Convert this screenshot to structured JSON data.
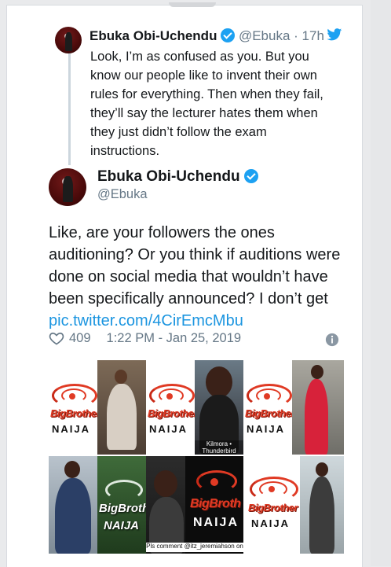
{
  "quoted_tweet": {
    "display_name": "Ebuka Obi-Uchendu",
    "handle": "@Ebuka",
    "separator": "·",
    "time_ago": "17h",
    "text": "Look, I’m as confused as you. But you know our people like to invent their own rules for everything. Then when they fail, they’ll say the lecturer hates them when they just didn’t follow the exam instructions."
  },
  "main_tweet": {
    "display_name": "Ebuka Obi-Uchendu",
    "handle": "@Ebuka",
    "text": "Like, are your followers the ones auditioning? Or you think if auditions were done on social media that wouldn’t have been specifically announced? I don’t get ",
    "link": "pic.twitter.com/4CirEmcMbu",
    "likes": "409",
    "timestamp": "1:22 PM - Jan 25, 2019"
  },
  "media": {
    "logo_word": "BigBrother",
    "logo_word_short": "BigBroth",
    "logo_naija": "NAIJA",
    "caption_1": "Kilmora • Thunderbird",
    "caption_2": "Pls comment @itz_jeremiahson on"
  },
  "colors": {
    "accent": "#1da1f2",
    "link": "#1b95e0",
    "bbn_red": "#e03a24",
    "muted_text": "#657786"
  },
  "icons": {
    "verified": "verified-badge-icon",
    "twitter": "twitter-bird-icon",
    "like": "heart-icon",
    "info": "info-icon"
  }
}
